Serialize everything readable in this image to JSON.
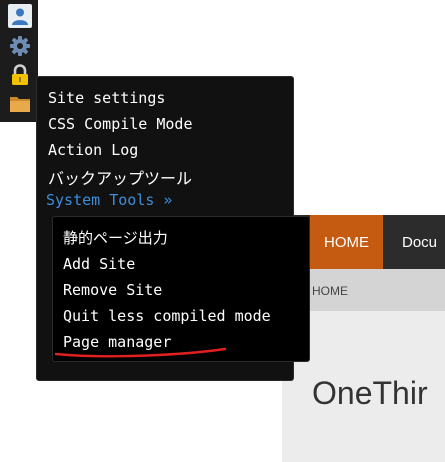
{
  "toolbar": {
    "icons": [
      "user-icon",
      "gear-icon",
      "lock-icon",
      "folder-icon"
    ],
    "user_bg": "#e9eef3",
    "user_color": "#3a78c0",
    "gear_color": "#6e8bb4",
    "lock_color": "#f2c200",
    "folder_color": "#e0a040"
  },
  "menu": {
    "items": [
      {
        "label": "Site settings"
      },
      {
        "label": "CSS Compile Mode"
      },
      {
        "label": "Action Log"
      },
      {
        "label": "バックアップツール"
      },
      {
        "label": "System Tools »"
      }
    ],
    "highlight_color": "#3f8dd9"
  },
  "submenu": {
    "items": [
      {
        "label": "静的ページ出力"
      },
      {
        "label": "Add Site"
      },
      {
        "label": "Remove Site"
      },
      {
        "label": "Quit less compiled mode"
      },
      {
        "label": "Page manager"
      }
    ],
    "annotation_color": "#e0201c"
  },
  "site": {
    "nav": {
      "home": "HOME",
      "docs": "Docu"
    },
    "breadcrumb": "HOME",
    "title": "OneThir",
    "accent": "#c55a11"
  }
}
